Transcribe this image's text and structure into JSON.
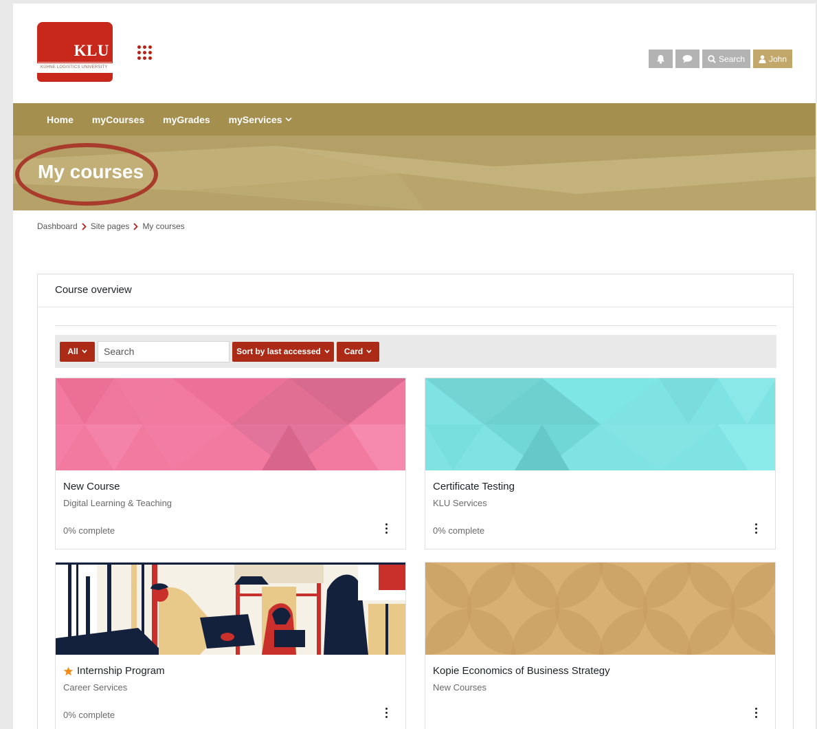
{
  "header": {
    "logo_text": "KLU",
    "logo_subtext": "KÜHNE LOGISTICS UNIVERSITY",
    "search_label": "Search",
    "user_label": "John"
  },
  "nav": {
    "items": [
      {
        "label": "Home"
      },
      {
        "label": "myCourses"
      },
      {
        "label": "myGrades"
      },
      {
        "label": "myServices"
      }
    ]
  },
  "banner": {
    "title": "My courses"
  },
  "breadcrumb": [
    "Dashboard",
    "Site pages",
    "My courses"
  ],
  "overview": {
    "title": "Course overview",
    "filter_label": "All",
    "search_placeholder": "Search",
    "sort_label": "Sort by last accessed",
    "view_label": "Card"
  },
  "courses": [
    {
      "title": "New Course",
      "category": "Digital Learning & Teaching",
      "progress_text": "0% complete",
      "starred": false,
      "image": "pink-triangles"
    },
    {
      "title": "Certificate Testing",
      "category": "KLU Services",
      "progress_text": "0% complete",
      "starred": false,
      "image": "cyan-triangles"
    },
    {
      "title": "Internship Program",
      "category": "Career Services",
      "progress_text": "0% complete",
      "starred": true,
      "image": "office-illustration"
    },
    {
      "title": "Kopie Economics of Business Strategy",
      "category": "New Courses",
      "progress_text": "",
      "starred": false,
      "image": "gold-circles"
    }
  ],
  "colors": {
    "brand_red": "#c8281c",
    "nav_gold": "#a48f4f",
    "banner_gold": "#bca96f",
    "button_red": "#ab2b16",
    "highlight_ring": "#a83b2b"
  }
}
